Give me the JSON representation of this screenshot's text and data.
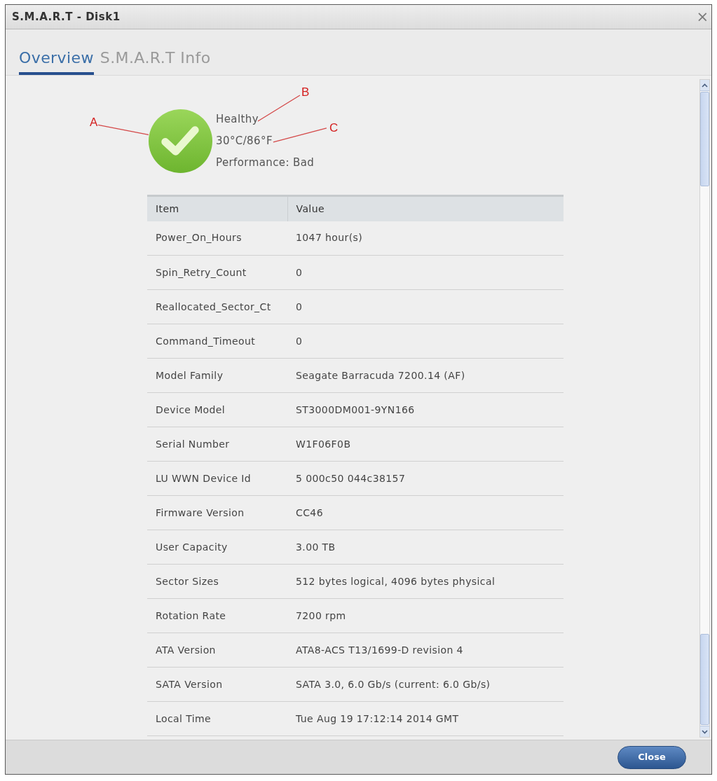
{
  "window": {
    "title": "S.M.A.R.T - Disk1",
    "close_glyph": "×"
  },
  "tabs": [
    {
      "label": "Overview",
      "selected": true
    },
    {
      "label": "S.M.A.R.T Info",
      "selected": false
    }
  ],
  "status": {
    "kind": "healthy",
    "annotation": "A",
    "lines": [
      {
        "text": "Healthy",
        "annotation": "B"
      },
      {
        "text": "30°C/86°F",
        "annotation": "C"
      },
      {
        "text": "Performance: Bad"
      }
    ]
  },
  "table": {
    "columns": [
      "Item",
      "Value"
    ],
    "rows": [
      [
        "Power_On_Hours",
        "1047 hour(s)"
      ],
      [
        "Spin_Retry_Count",
        "0"
      ],
      [
        "Reallocated_Sector_Ct",
        "0"
      ],
      [
        "Command_Timeout",
        "0"
      ],
      [
        "Model Family",
        "Seagate Barracuda 7200.14 (AF)"
      ],
      [
        "Device Model",
        "ST3000DM001-9YN166"
      ],
      [
        "Serial Number",
        "W1F06F0B"
      ],
      [
        "LU WWN Device Id",
        "5 000c50 044c38157"
      ],
      [
        "Firmware Version",
        "CC46"
      ],
      [
        "User Capacity",
        "3.00 TB"
      ],
      [
        "Sector Sizes",
        "512 bytes logical, 4096 bytes physical"
      ],
      [
        "Rotation Rate",
        "7200 rpm"
      ],
      [
        "ATA Version",
        "ATA8-ACS T13/1699-D revision 4"
      ],
      [
        "SATA Version",
        "SATA 3.0, 6.0 Gb/s (current: 6.0 Gb/s)"
      ],
      [
        "Local Time",
        "Tue Aug 19 17:12:14 2014 GMT"
      ]
    ]
  },
  "footer": {
    "buttons": [
      "Close"
    ]
  }
}
